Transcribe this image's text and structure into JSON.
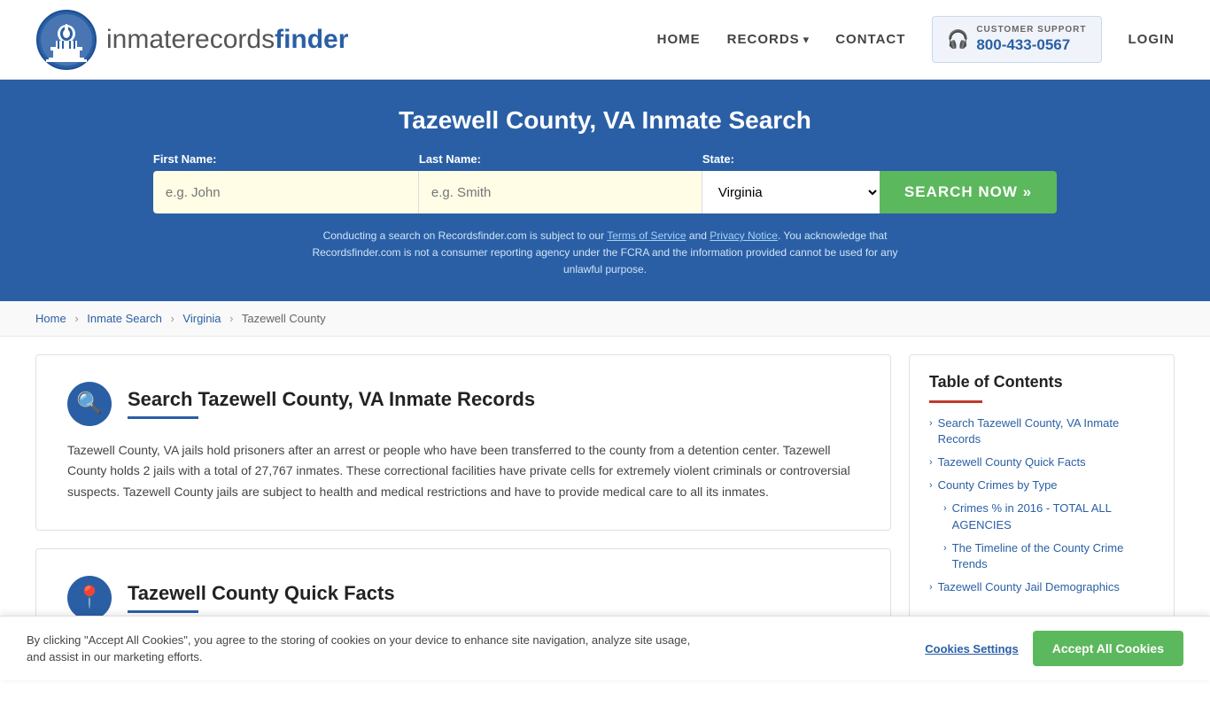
{
  "header": {
    "logo_text_normal": "inmaterecords",
    "logo_text_bold": "finder",
    "nav": {
      "home_label": "HOME",
      "records_label": "RECORDS",
      "contact_label": "CONTACT",
      "login_label": "LOGIN"
    },
    "support": {
      "label": "CUSTOMER SUPPORT",
      "number": "800-433-0567"
    }
  },
  "search_banner": {
    "title": "Tazewell County, VA Inmate Search",
    "first_name_label": "First Name:",
    "first_name_placeholder": "e.g. John",
    "last_name_label": "Last Name:",
    "last_name_placeholder": "e.g. Smith",
    "state_label": "State:",
    "state_value": "Virginia",
    "search_btn_label": "SEARCH NOW »",
    "disclaimer": "Conducting a search on Recordsfinder.com is subject to our Terms of Service and Privacy Notice. You acknowledge that Recordsfinder.com is not a consumer reporting agency under the FCRA and the information provided cannot be used for any unlawful purpose."
  },
  "breadcrumb": {
    "home": "Home",
    "inmate_search": "Inmate Search",
    "virginia": "Virginia",
    "tazewell_county": "Tazewell County"
  },
  "main_section": {
    "card1": {
      "title": "Search Tazewell County, VA Inmate Records",
      "body": "Tazewell County, VA jails hold prisoners after an arrest or people who have been transferred to the county from a detention center. Tazewell County holds 2 jails with a total of 27,767 inmates. These correctional facilities have private cells for extremely violent criminals or controversial suspects. Tazewell County jails are subject to health and medical restrictions and have to provide medical care to all its inmates."
    },
    "card2": {
      "title": "Tazewell County Quick Facts"
    }
  },
  "sidebar": {
    "toc_title": "Table of Contents",
    "items": [
      {
        "label": "Search Tazewell County, VA Inmate Records",
        "sub": false
      },
      {
        "label": "Tazewell County Quick Facts",
        "sub": false
      },
      {
        "label": "County Crimes by Type",
        "sub": false
      },
      {
        "label": "Crimes % in 2016 - TOTAL ALL AGENCIES",
        "sub": true
      },
      {
        "label": "The Timeline of the County Crime Trends",
        "sub": true
      },
      {
        "label": "Tazewell County Jail Demographics",
        "sub": false
      }
    ]
  },
  "cookie_banner": {
    "text": "By clicking \"Accept All Cookies\", you agree to the storing of cookies on your device to enhance site navigation, analyze site usage, and assist in our marketing efforts.",
    "settings_label": "Cookies Settings",
    "accept_label": "Accept All Cookies"
  },
  "icons": {
    "search": "🔍",
    "headset": "🎧",
    "chevron_right": "›",
    "chevron_down": "▾",
    "map_marker": "📍"
  }
}
